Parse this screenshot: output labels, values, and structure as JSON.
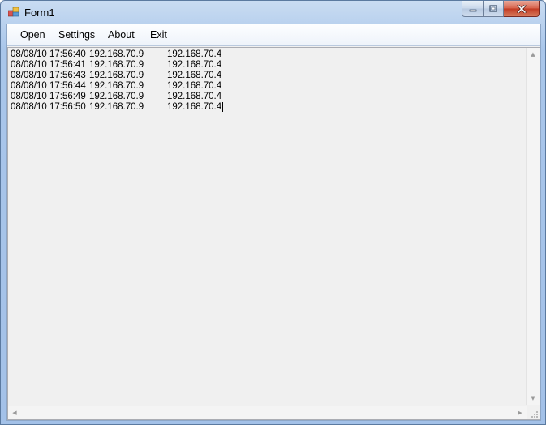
{
  "window": {
    "title": "Form1",
    "icon": "app-icon",
    "buttons": {
      "minimize": "minimize-icon",
      "maximize": "maximize-icon",
      "close": "close-icon"
    }
  },
  "menu": {
    "open_label": "Open",
    "settings_label": "Settings",
    "about_label": "About",
    "exit_label": "Exit"
  },
  "log": {
    "rows": [
      {
        "timestamp": "08/08/10 17:56:40",
        "source": "192.168.70.9",
        "destination": "192.168.70.4"
      },
      {
        "timestamp": "08/08/10 17:56:41",
        "source": "192.168.70.9",
        "destination": "192.168.70.4"
      },
      {
        "timestamp": "08/08/10 17:56:43",
        "source": "192.168.70.9",
        "destination": "192.168.70.4"
      },
      {
        "timestamp": "08/08/10 17:56:44",
        "source": "192.168.70.9",
        "destination": "192.168.70.4"
      },
      {
        "timestamp": "08/08/10 17:56:49",
        "source": "192.168.70.9",
        "destination": "192.168.70.4"
      },
      {
        "timestamp": "08/08/10 17:56:50",
        "source": "192.168.70.9",
        "destination": "192.168.70.4"
      }
    ]
  },
  "colors": {
    "frame": "#a9c6ea",
    "client": "#f0f0f0",
    "close_button": "#c13a22"
  }
}
